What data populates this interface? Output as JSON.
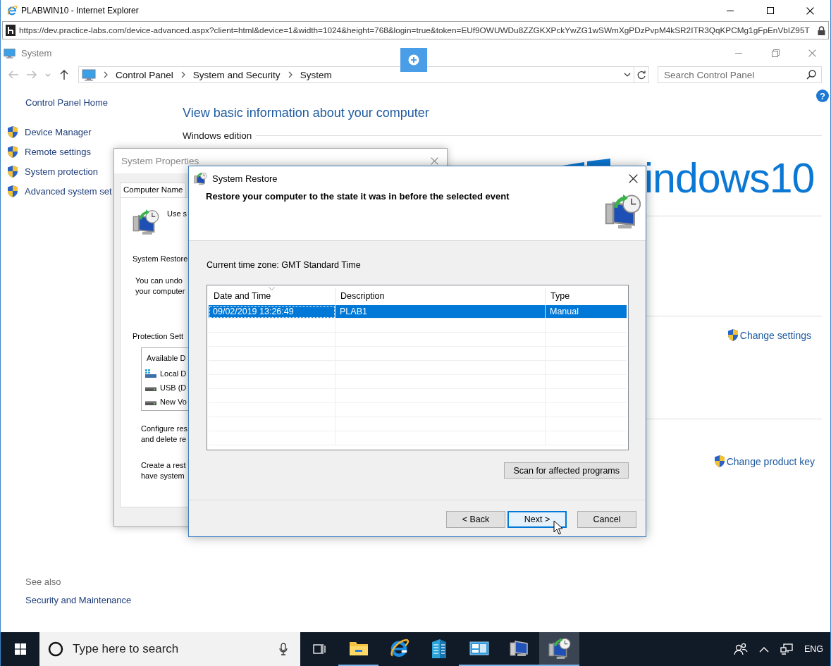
{
  "browser": {
    "title": "PLABWIN10 - Internet Explorer",
    "url": "https://dev.practice-labs.com/device-advanced.aspx?client=html&device=1&width=1024&height=768&login=true&token=EUf9OWUWDu8ZZGKXPckYwZG1wSWmXgPDzPvpM4kSR2ITR3QqKPCMg1gFpEnVbIZ95T"
  },
  "control_panel": {
    "title": "System",
    "breadcrumb": [
      "Control Panel",
      "System and Security",
      "System"
    ],
    "search": {
      "placeholder": "Search Control Panel"
    },
    "help": "?",
    "sidebar": {
      "home": "Control Panel Home",
      "links": [
        "Device Manager",
        "Remote settings",
        "System protection",
        "Advanced system set"
      ]
    },
    "heading": "View basic information about your computer",
    "section": "Windows edition",
    "logo_text": "indows10",
    "actions": [
      "Change settings",
      "Change product key"
    ],
    "see_also": {
      "title": "See also",
      "links": [
        "Security and Maintenance"
      ]
    }
  },
  "system_properties": {
    "title": "System Properties",
    "tab": "Computer Name",
    "intro": "Use s",
    "section": "System Restore",
    "text": [
      "You can undo",
      "your computer"
    ],
    "protection": "Protection Sett",
    "drives_header": "Available D",
    "drives": [
      {
        "kind": "system",
        "name": "Local D"
      },
      {
        "kind": "drive",
        "name": "USB (D"
      },
      {
        "kind": "drive",
        "name": "New Vo"
      }
    ],
    "configure": [
      "Configure res",
      "and delete re"
    ],
    "create": [
      "Create a rest",
      "have system"
    ]
  },
  "system_restore": {
    "title": "System Restore",
    "heading": "Restore your computer to the state it was in before the selected event",
    "timezone": "Current time zone: GMT Standard Time",
    "columns": [
      "Date and Time",
      "Description",
      "Type"
    ],
    "rows": [
      {
        "date": "09/02/2019 13:26:49",
        "description": "PLAB1",
        "type": "Manual",
        "selected": true
      }
    ],
    "scan_button": "Scan for affected programs",
    "buttons": [
      {
        "label": "< Back",
        "default": false
      },
      {
        "label": "Next >",
        "default": true
      },
      {
        "label": "Cancel",
        "default": false
      }
    ]
  },
  "taskbar": {
    "search": {
      "placeholder": "Type here to search"
    },
    "apps": [
      {
        "kind": "explorer",
        "running": true,
        "active": false
      },
      {
        "kind": "ie",
        "running": false,
        "active": false
      },
      {
        "kind": "server",
        "running": false,
        "active": false
      },
      {
        "kind": "panel",
        "running": true,
        "active": false
      },
      {
        "kind": "remote",
        "running": true,
        "active": false
      },
      {
        "kind": "restore",
        "running": true,
        "active": true
      }
    ],
    "language": "ENG"
  }
}
